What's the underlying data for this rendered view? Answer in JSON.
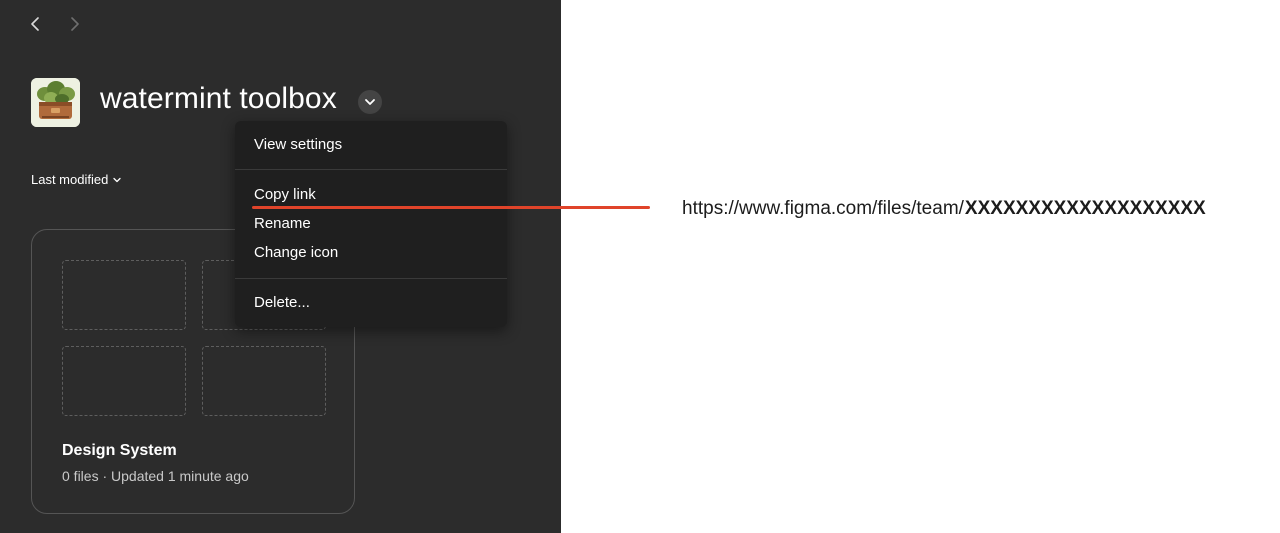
{
  "nav": {
    "back_icon": "chevron-left-icon",
    "forward_icon": "chevron-right-icon"
  },
  "team": {
    "title": "watermint toolbox",
    "avatar_icon": "plant-toolbox-icon",
    "menu_toggle_icon": "chevron-down-icon"
  },
  "sort": {
    "label": "Last modified",
    "icon": "chevron-down-icon"
  },
  "menu": {
    "items": [
      {
        "label": "View settings"
      },
      {
        "label": "Copy link"
      },
      {
        "label": "Rename"
      },
      {
        "label": "Change icon"
      },
      {
        "label": "Delete..."
      }
    ]
  },
  "project": {
    "name": "Design System",
    "meta": "0 files · Updated 1 minute ago"
  },
  "annotation": {
    "url_prefix": "https://www.figma.com/files/team/",
    "url_redacted": "XXXXXXXXXXXXXXXXXXX",
    "line_color": "#e0442a",
    "highlight_color": "#f9b8f4"
  },
  "colors": {
    "panel_bg": "#2c2c2c",
    "menu_bg": "#1f1f1f"
  }
}
